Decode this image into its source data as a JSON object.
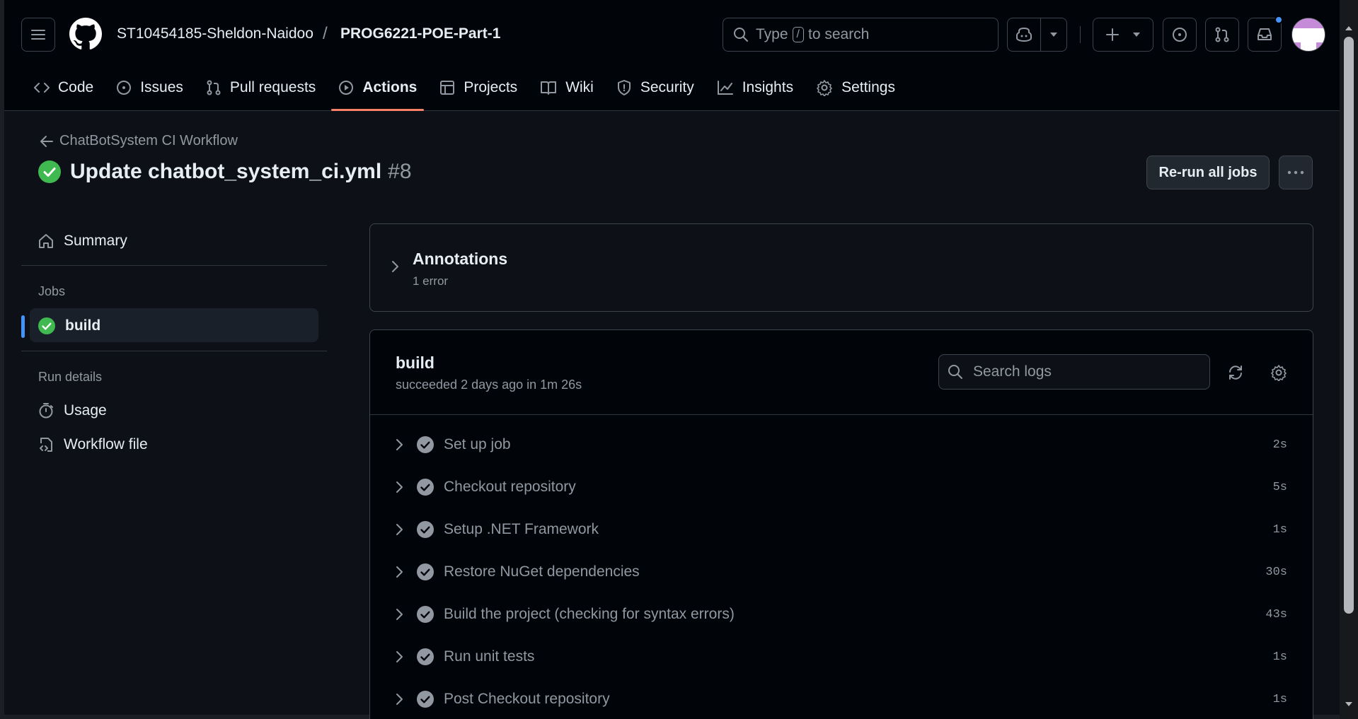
{
  "header": {
    "owner": "ST10454185-Sheldon-Naidoo",
    "separator": "/",
    "repo": "PROG6221-POE-Part-1",
    "search": {
      "prefix": "Type",
      "key": "/",
      "suffix": "to search"
    }
  },
  "tabs": [
    {
      "label": "Code",
      "icon": "code-icon"
    },
    {
      "label": "Issues",
      "icon": "issue-icon"
    },
    {
      "label": "Pull requests",
      "icon": "pull-request-icon"
    },
    {
      "label": "Actions",
      "icon": "play-icon",
      "active": true
    },
    {
      "label": "Projects",
      "icon": "table-icon"
    },
    {
      "label": "Wiki",
      "icon": "book-icon"
    },
    {
      "label": "Security",
      "icon": "shield-icon"
    },
    {
      "label": "Insights",
      "icon": "graph-icon"
    },
    {
      "label": "Settings",
      "icon": "gear-icon"
    }
  ],
  "run": {
    "workflow_name": "ChatBotSystem CI Workflow",
    "title": "Update chatbot_system_ci.yml",
    "number": "#8",
    "rerun_label": "Re-run all jobs"
  },
  "sidebar": {
    "summary": "Summary",
    "jobs_heading": "Jobs",
    "job": "build",
    "run_details_heading": "Run details",
    "usage": "Usage",
    "workflow_file": "Workflow file"
  },
  "annotations": {
    "title": "Annotations",
    "subtitle": "1 error"
  },
  "job": {
    "name": "build",
    "status": "succeeded 2 days ago in 1m 26s",
    "search_placeholder": "Search logs",
    "steps": [
      {
        "name": "Set up job",
        "duration": "2s"
      },
      {
        "name": "Checkout repository",
        "duration": "5s"
      },
      {
        "name": "Setup .NET Framework",
        "duration": "1s"
      },
      {
        "name": "Restore NuGet dependencies",
        "duration": "30s"
      },
      {
        "name": "Build the project (checking for syntax errors)",
        "duration": "43s"
      },
      {
        "name": "Run unit tests",
        "duration": "1s"
      },
      {
        "name": "Post Checkout repository",
        "duration": "1s"
      }
    ]
  },
  "colors": {
    "success": "#3fb950",
    "active_tab_underline": "#f78166",
    "selected_indicator": "#4493f8",
    "notification_dot": "#4493f8"
  }
}
